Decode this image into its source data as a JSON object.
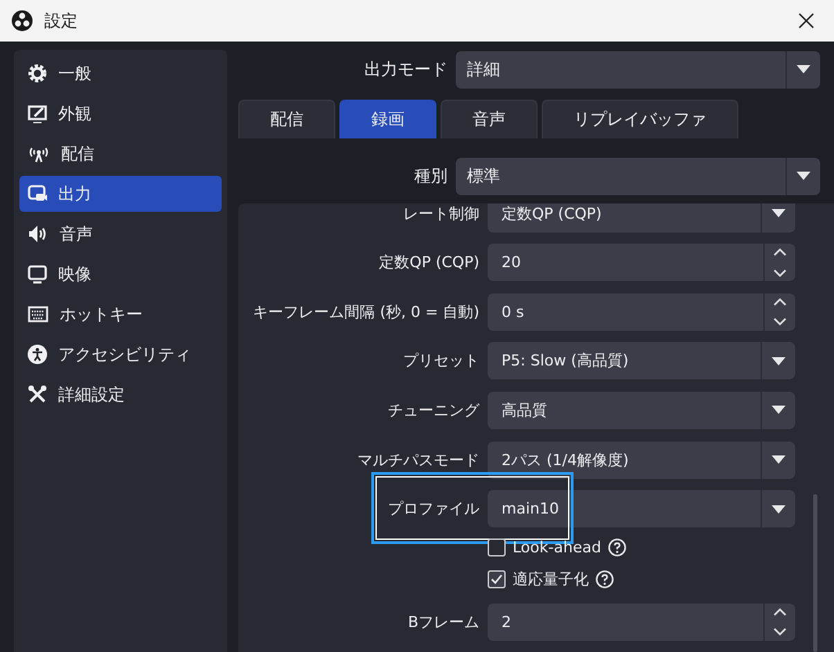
{
  "window": {
    "title": "設定"
  },
  "sidebar": {
    "items": [
      {
        "label": "一般",
        "selected": false
      },
      {
        "label": "外観",
        "selected": false
      },
      {
        "label": "配信",
        "selected": false
      },
      {
        "label": "出力",
        "selected": true
      },
      {
        "label": "音声",
        "selected": false
      },
      {
        "label": "映像",
        "selected": false
      },
      {
        "label": "ホットキー",
        "selected": false
      },
      {
        "label": "アクセシビリティ",
        "selected": false
      },
      {
        "label": "詳細設定",
        "selected": false
      }
    ]
  },
  "output_mode": {
    "label": "出力モード",
    "value": "詳細"
  },
  "tabs": [
    {
      "label": "配信",
      "selected": false
    },
    {
      "label": "録画",
      "selected": true
    },
    {
      "label": "音声",
      "selected": false
    },
    {
      "label": "リプレイバッファ",
      "selected": false
    }
  ],
  "type": {
    "label": "種別",
    "value": "標準"
  },
  "settings": [
    {
      "kind": "combo",
      "label": "レート制御",
      "value": "定数QP (CQP)",
      "highlighted": false
    },
    {
      "kind": "spin",
      "label": "定数QP (CQP)",
      "value": "20",
      "highlighted": false
    },
    {
      "kind": "spin",
      "label": "キーフレーム間隔 (秒, 0 = 自動)",
      "value": "0 s",
      "highlighted": false
    },
    {
      "kind": "combo",
      "label": "プリセット",
      "value": "P5: Slow (高品質)",
      "highlighted": false
    },
    {
      "kind": "combo",
      "label": "チューニング",
      "value": "高品質",
      "highlighted": false
    },
    {
      "kind": "combo",
      "label": "マルチパスモード",
      "value": "2パス (1/4解像度)",
      "highlighted": false
    },
    {
      "kind": "combo",
      "label": "プロファイル",
      "value": "main10",
      "highlighted": true
    },
    {
      "kind": "check",
      "label": "Look-ahead",
      "checked": false
    },
    {
      "kind": "check",
      "label": "適応量子化",
      "checked": true
    },
    {
      "kind": "spin",
      "label": "Bフレーム",
      "value": "2",
      "highlighted": false
    }
  ]
}
